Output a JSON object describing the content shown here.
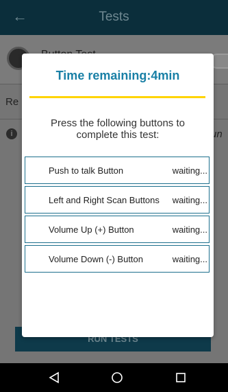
{
  "app": {
    "title": "Tests",
    "row1_label": "Button Test",
    "row2_text": "Re",
    "row3_text": "un",
    "run_button": "RUN TESTS"
  },
  "dialog": {
    "title": "Time remaining:4min",
    "instruction": "Press the following buttons to complete this test:",
    "tests": [
      {
        "name": "Push to talk Button",
        "status": "waiting..."
      },
      {
        "name": "Left and Right Scan Buttons",
        "status": "waiting..."
      },
      {
        "name": "Volume Up (+) Button",
        "status": "waiting..."
      },
      {
        "name": "Volume Down (-) Button",
        "status": "waiting..."
      }
    ]
  },
  "colors": {
    "accent": "#1a80a6",
    "divider": "#ffd400",
    "appbar": "#0b2e3b"
  },
  "icons": {
    "back": "back-arrow-icon",
    "nav_back": "triangle-back-icon",
    "nav_home": "circle-home-icon",
    "nav_recent": "square-recents-icon",
    "info": "info-icon"
  }
}
